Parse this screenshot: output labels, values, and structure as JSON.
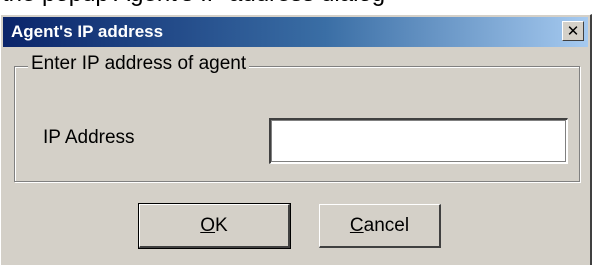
{
  "background": {
    "text": "the popup Agent's IP address dialog"
  },
  "dialog": {
    "title": "Agent's IP address",
    "close_icon": "close-icon",
    "group_legend": "Enter IP address of agent",
    "ip_field": {
      "label": "IP Address",
      "value": ""
    },
    "ok_button": {
      "accel": "O",
      "rest": "K"
    },
    "cancel_button": {
      "accel": "C",
      "rest": "ancel"
    }
  },
  "colors": {
    "titlebar_start": "#0a246a",
    "titlebar_end": "#a6caf0",
    "dialog_face": "#d4d0c8"
  }
}
